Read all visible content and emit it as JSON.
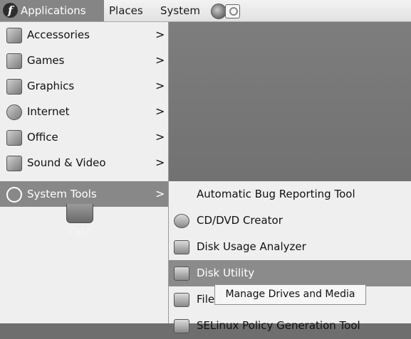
{
  "panel": {
    "applications_label": "Applications",
    "places_label": "Places",
    "system_label": "System",
    "icons": [
      "fedora-logo",
      "firefox-globe-icon",
      "mail-icon"
    ]
  },
  "menu": {
    "items": [
      {
        "label": "Accessories",
        "icon": "accessories-icon"
      },
      {
        "label": "Games",
        "icon": "games-icon"
      },
      {
        "label": "Graphics",
        "icon": "graphics-icon"
      },
      {
        "label": "Internet",
        "icon": "internet-icon"
      },
      {
        "label": "Office",
        "icon": "office-icon"
      },
      {
        "label": "Sound & Video",
        "icon": "sound-video-icon"
      },
      {
        "label": "System Tools",
        "icon": "system-tools-icon",
        "active": true
      }
    ],
    "arrow": ">"
  },
  "desktop": {
    "trash_label": "Trash"
  },
  "submenu": {
    "items": [
      {
        "label": "Automatic Bug Reporting Tool"
      },
      {
        "label": "CD/DVD Creator",
        "icon": "cd-dvd-icon"
      },
      {
        "label": "Disk Usage Analyzer",
        "icon": "disk-usage-icon"
      },
      {
        "label": "Disk Utility",
        "icon": "disk-utility-icon",
        "active": true
      },
      {
        "label": "File",
        "icon": "file-icon"
      },
      {
        "label": "SELinux Policy Generation Tool",
        "icon": "selinux-icon"
      }
    ]
  },
  "tooltip": {
    "text": "Manage Drives and Media"
  }
}
